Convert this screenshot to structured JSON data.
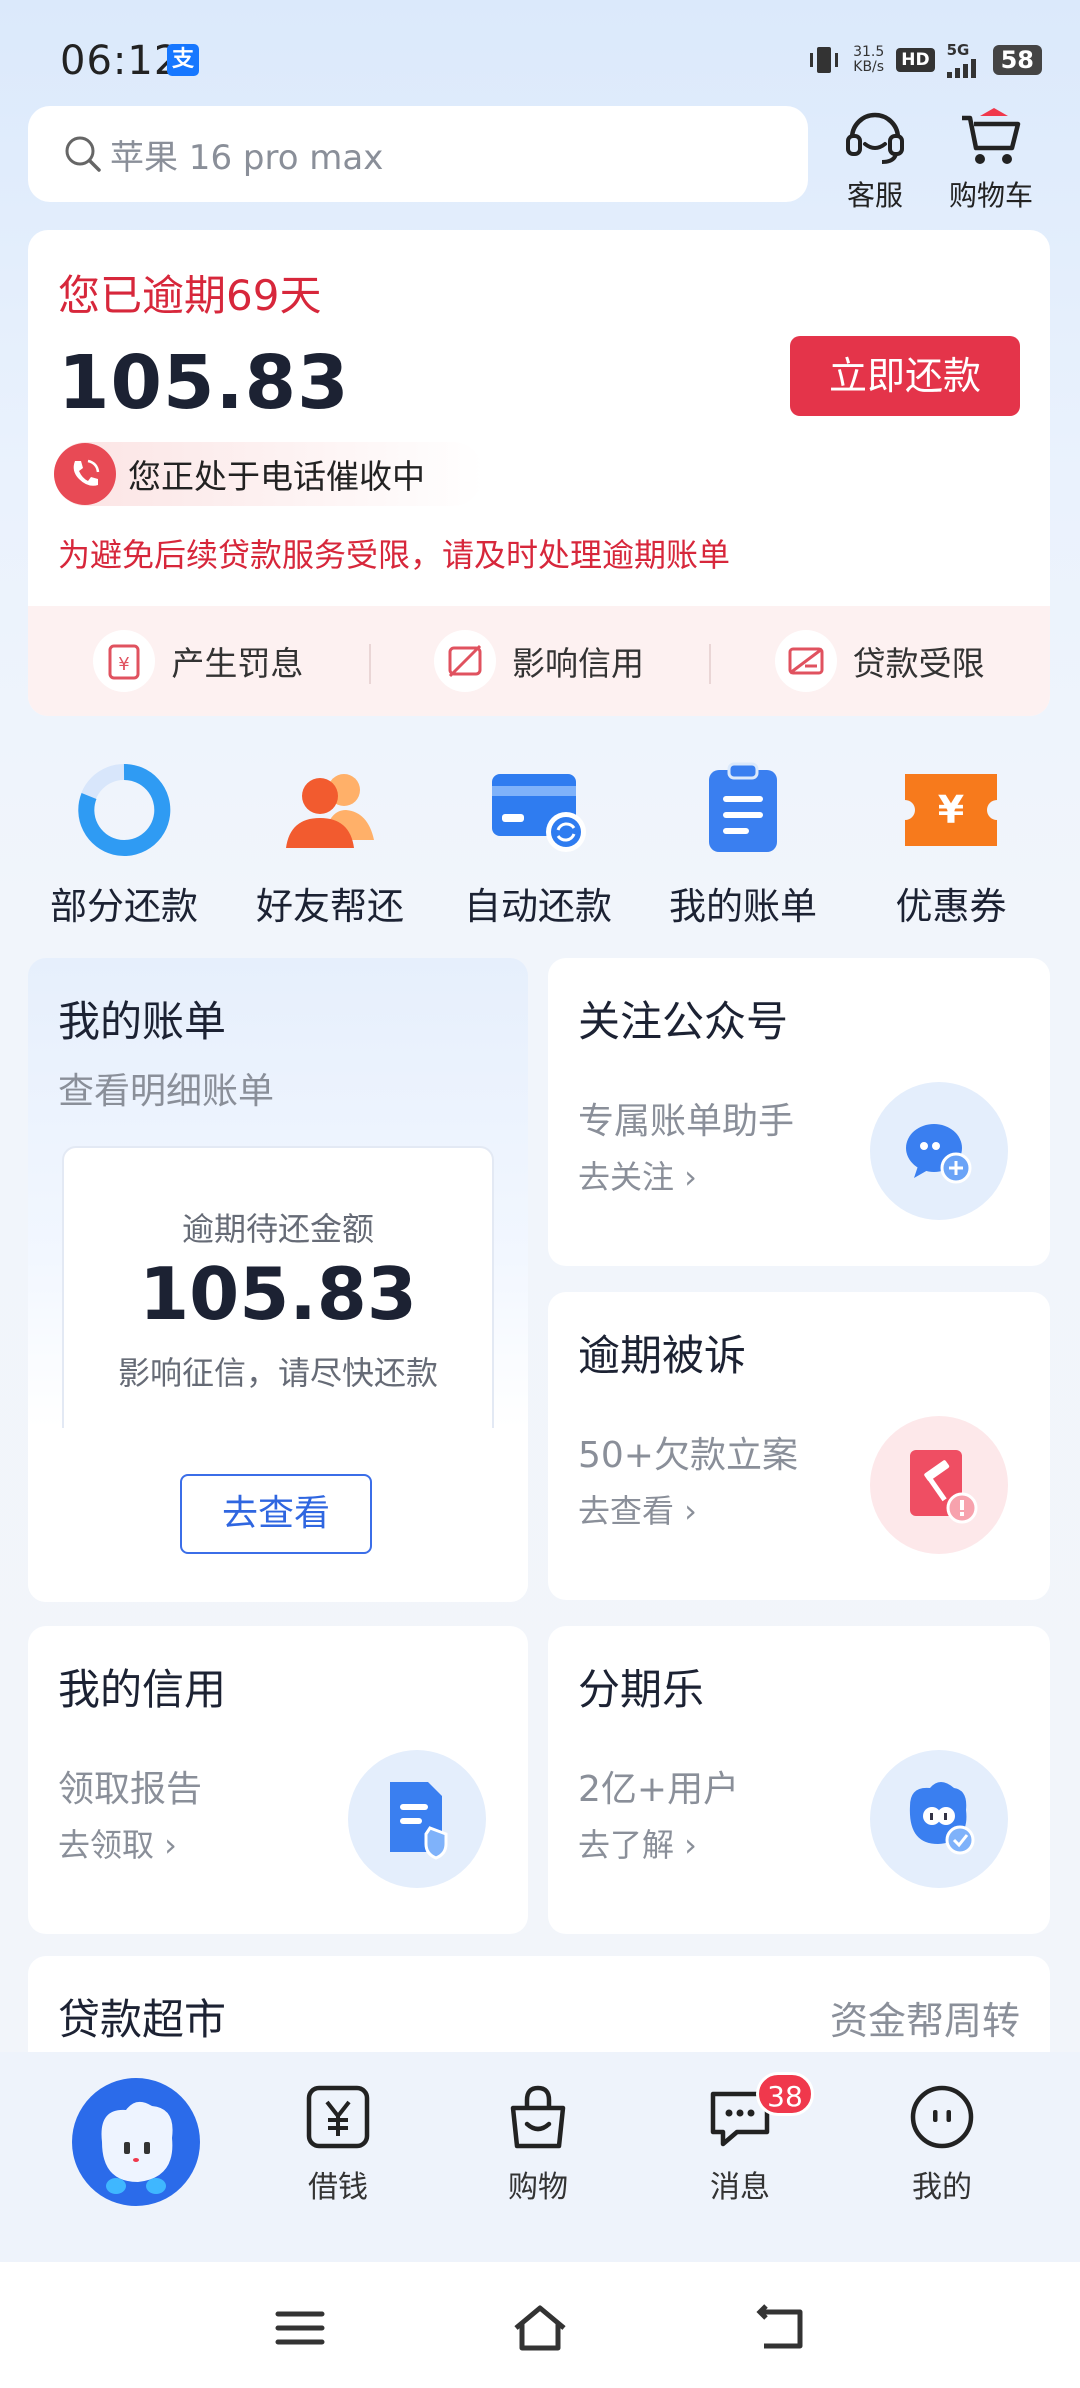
{
  "status_bar": {
    "time": "06:12",
    "alipay_badge": "支",
    "net_speed_value": "31.5",
    "net_speed_unit": "KB/s",
    "hd": "HD",
    "network": "5G",
    "battery": "58"
  },
  "search": {
    "placeholder": "苹果 16 pro max"
  },
  "top_actions": {
    "service": "客服",
    "cart": "购物车"
  },
  "overdue": {
    "title": "您已逾期69天",
    "amount": "105.83",
    "repay_button": "立即还款",
    "call_status": "您正处于电话催收中",
    "warning": "为避免后续贷款服务受限，请及时处理逾期账单",
    "penalties": [
      "产生罚息",
      "影响信用",
      "贷款受限"
    ]
  },
  "quick_actions": [
    "部分还款",
    "好友帮还",
    "自动还款",
    "我的账单",
    "优惠券"
  ],
  "bill_card": {
    "title": "我的账单",
    "subtitle": "查看明细账单",
    "inner_label": "逾期待还金额",
    "inner_amount": "105.83",
    "inner_note": "影响征信，请尽快还款",
    "button": "去查看"
  },
  "wechat_card": {
    "title": "关注公众号",
    "subtitle": "专属账单助手",
    "link": "去关注 ›"
  },
  "sued_card": {
    "title": "逾期被诉",
    "subtitle": "50+欠款立案",
    "link": "去查看 ›"
  },
  "credit_card": {
    "title": "我的信用",
    "subtitle": "领取报告",
    "link": "去领取 ›"
  },
  "fenqi_card": {
    "title": "分期乐",
    "subtitle": "2亿+用户",
    "link": "去了解 ›"
  },
  "loan_market": {
    "title": "贷款超市",
    "right": "资金帮周转"
  },
  "bottom_nav": {
    "borrow": "借钱",
    "shop": "购物",
    "message": "消息",
    "message_badge": "38",
    "mine": "我的"
  },
  "colors": {
    "accent_red": "#e4344a",
    "brand_blue": "#2b6bea",
    "overdue_text": "#d7273b"
  }
}
